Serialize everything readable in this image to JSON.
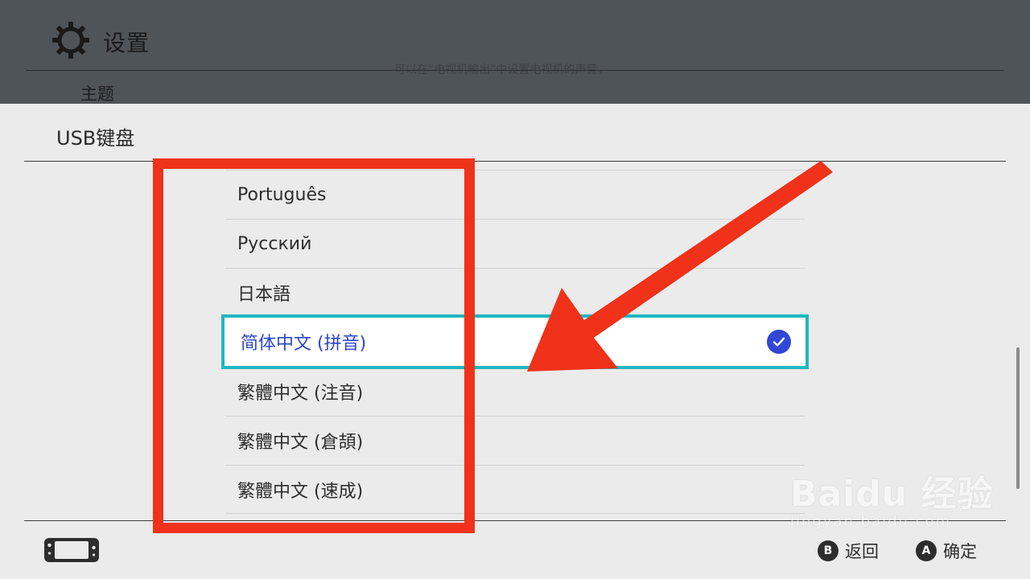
{
  "background": {
    "title": "设置",
    "hint": "可以在“电视机输出”中设置电视机的声音。",
    "theme_label": "主题"
  },
  "dialog": {
    "title": "USB键盘",
    "languages": [
      {
        "label": "Português",
        "selected": false
      },
      {
        "label": "Русский",
        "selected": false
      },
      {
        "label": "日本語",
        "selected": false
      },
      {
        "label": "简体中文 (拼音)",
        "selected": true
      },
      {
        "label": "繁體中文 (注音)",
        "selected": false
      },
      {
        "label": "繁體中文 (倉頡)",
        "selected": false
      },
      {
        "label": "繁體中文 (速成)",
        "selected": false
      }
    ]
  },
  "footer": {
    "back_glyph": "B",
    "back_label": "返回",
    "confirm_glyph": "A",
    "confirm_label": "确定"
  },
  "watermark": {
    "logo": "Baidu 经验",
    "url": "jingyan.baidu.com"
  },
  "colors": {
    "selection_border": "#1fb7c0",
    "selected_text": "#2c46c7",
    "check": "#3147d6",
    "annotation_red": "#ef3219"
  }
}
